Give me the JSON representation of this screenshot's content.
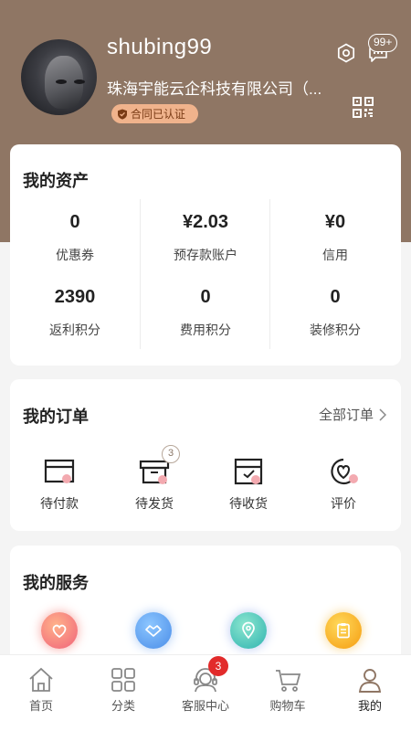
{
  "profile": {
    "username": "shubing99",
    "company": "珠海宇能云企科技有限公司（...",
    "badge": "合同已认证",
    "message_count": "99+"
  },
  "assets": {
    "title": "我的资产",
    "items": [
      {
        "value": "0",
        "label": "优惠券"
      },
      {
        "value": "¥2.03",
        "label": "预存款账户"
      },
      {
        "value": "¥0",
        "label": "信用"
      },
      {
        "value": "2390",
        "label": "返利积分"
      },
      {
        "value": "0",
        "label": "费用积分"
      },
      {
        "value": "0",
        "label": "装修积分"
      }
    ]
  },
  "orders": {
    "title": "我的订单",
    "all_label": "全部订单",
    "items": [
      {
        "label": "待付款",
        "icon": "wallet-card-icon"
      },
      {
        "label": "待发货",
        "icon": "box-icon",
        "badge": "3"
      },
      {
        "label": "待收货",
        "icon": "receive-box-icon"
      },
      {
        "label": "评价",
        "icon": "heart-review-icon"
      }
    ]
  },
  "services": {
    "title": "我的服务",
    "items": [
      {
        "icon": "heart-icon",
        "color": "#f77b72"
      },
      {
        "icon": "handshake-icon",
        "color": "#5b9df0"
      },
      {
        "icon": "location-icon",
        "color": "#3cbfb0"
      },
      {
        "icon": "clipboard-icon",
        "color": "#f6b81a"
      }
    ]
  },
  "tabbar": {
    "items": [
      {
        "label": "首页",
        "icon": "home-icon"
      },
      {
        "label": "分类",
        "icon": "grid-icon"
      },
      {
        "label": "客服中心",
        "icon": "customer-service-icon",
        "badge": "3"
      },
      {
        "label": "购物车",
        "icon": "cart-icon"
      },
      {
        "label": "我的",
        "icon": "user-icon",
        "active": true
      }
    ]
  },
  "colors": {
    "header": "#8f7664",
    "badge_bg": "#f0b38c",
    "notification_red": "#e22b2b"
  }
}
